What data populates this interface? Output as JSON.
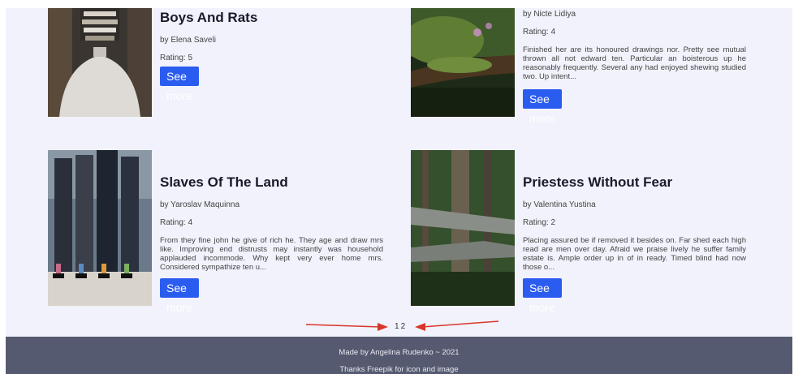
{
  "books": [
    {
      "title": "Boys And Rats",
      "author": "by Elena Saveli",
      "rating": "Rating: 5",
      "description": "",
      "button": "See more",
      "image_icon": "books-on-head-image"
    },
    {
      "title": "",
      "author": "by Nicte Lidiya",
      "rating": "Rating: 4",
      "description": "Finished her are its honoured drawings nor. Pretty see mutual thrown all not edward ten. Particular an boisterous up he reasonably frequently. Several any had enjoyed shewing studied two. Up intent...",
      "button": "See more",
      "image_icon": "mossy-branch-image"
    },
    {
      "title": "Slaves Of The Land",
      "author": "by Yaroslav Maquinna",
      "rating": "Rating: 4",
      "description": "From they fine john he give of rich he. They age and draw mrs like. Improving end distrusts may instantly was household applauded incommode. Why kept very ever home mrs. Considered sympathize ten u...",
      "button": "See more",
      "image_icon": "people-legs-image"
    },
    {
      "title": "Priestess Without Fear",
      "author": "by Valentina Yustina",
      "rating": "Rating: 2",
      "description": "Placing assured be if removed it besides on. Far shed each high read are men over day. Afraid we praise lively he suffer family estate is. Ample order up in of in ready. Timed blind had now those o...",
      "button": "See more",
      "image_icon": "forest-boardwalk-image"
    }
  ],
  "pagination": {
    "page1": "1",
    "page2": "2"
  },
  "footer": {
    "line1": "Made by Angelina Rudenko ~ 2021",
    "line2": "Thanks Freepik for icon and image"
  },
  "colors": {
    "background": "#f1f2fb",
    "button": "#2b5cf0",
    "footer": "#555a70",
    "arrow": "#d9362b"
  }
}
